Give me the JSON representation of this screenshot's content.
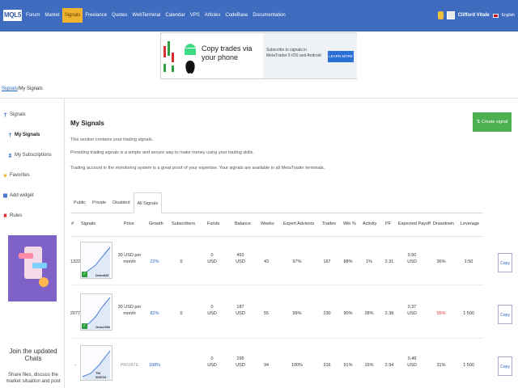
{
  "nav": {
    "logo": "MQL5",
    "items": [
      "Forum",
      "Market",
      "Signals",
      "Freelance",
      "Quotes",
      "WebTerminal",
      "Calendar",
      "VPS",
      "Articles",
      "CodeBase",
      "Documentation"
    ],
    "active_index": 2,
    "username": "Clifford Vitale",
    "language": "English"
  },
  "banner": {
    "title": "Copy trades via your phone",
    "text": "Subscribe to signals in MetaTrader 5 iOS and Android",
    "button": "LEARN MORE"
  },
  "breadcrumb": {
    "link": "Signals",
    "separator": "/",
    "current": "My Signals"
  },
  "sidebar": {
    "items": [
      {
        "label": "Signals",
        "icon": "signal-icon"
      },
      {
        "label": "My Signals",
        "icon": "signal-icon"
      },
      {
        "label": "My Subscriptions",
        "icon": "user-icon"
      },
      {
        "label": "Favorites",
        "icon": "star-icon"
      },
      {
        "label": "Add widget",
        "icon": "widget-icon"
      },
      {
        "label": "Rules",
        "icon": "bookmark-icon"
      }
    ],
    "promo_title": "Join the updated Chats",
    "promo_sub": "Share files, discuss the market situation and post"
  },
  "main": {
    "title": "My Signals",
    "desc": [
      "This section contains your trading signals.",
      "Providing trading signals is a simple and secure way to make money using your trading skills.",
      "Trading account in the monitoring system is a great proof of your expertise. Your signals are available in all MetaTrader terminals."
    ],
    "create_button": "Create signal",
    "tabs": [
      "Public",
      "Private",
      "Disabled",
      "All Signals"
    ],
    "active_tab": 3,
    "columns": [
      "#",
      "Signals",
      "Price",
      "Growth",
      "Subscribers",
      "Funds",
      "Balance",
      "Weeks",
      "Expert Advisors",
      "Trades",
      "Win %",
      "Activity",
      "PF",
      "Expected Payoff",
      "Drawdown",
      "Leverage"
    ],
    "rows": [
      {
        "id": "1322",
        "name": "Dean826",
        "price": "30 USD per month",
        "growth": "22%",
        "subscribers": "0",
        "funds": "0 USD",
        "balance": "493 USD",
        "weeks": "43",
        "ea": "97%",
        "trades": "167",
        "win": "88%",
        "activity": "1%",
        "pf": "2.31",
        "payoff": "0.50 USD",
        "drawdown": "36%",
        "leverage": "1:50",
        "copy": "Copy",
        "verified": true
      },
      {
        "id": "2077",
        "name": "Grace994",
        "price": "30 USD per month",
        "growth": "82%",
        "subscribers": "0",
        "funds": "0 USD",
        "balance": "187 USD",
        "weeks": "55",
        "ea": "99%",
        "trades": "230",
        "win": "90%",
        "activity": "28%",
        "pf": "2.38",
        "payoff": "0.37 USD",
        "drawdown": "55%",
        "leverage": "1:500",
        "copy": "Copy",
        "verified": true
      },
      {
        "id": "-",
        "name": "TM 008734",
        "price": "PRIVATE",
        "growth": "188%",
        "subscribers": "",
        "funds": "0 USD",
        "balance": "295 USD",
        "weeks": "94",
        "ea": "100%",
        "trades": "316",
        "win": "91%",
        "activity": "15%",
        "pf": "2.94",
        "payoff": "0.49 USD",
        "drawdown": "31%",
        "leverage": "1:500",
        "copy": "Copy",
        "verified": false
      }
    ]
  },
  "colors": {
    "nav": "#3f6cbf",
    "active_nav": "#f0b32e",
    "create": "#4caf50",
    "link": "#2b63c1",
    "red": "#d8302e"
  }
}
